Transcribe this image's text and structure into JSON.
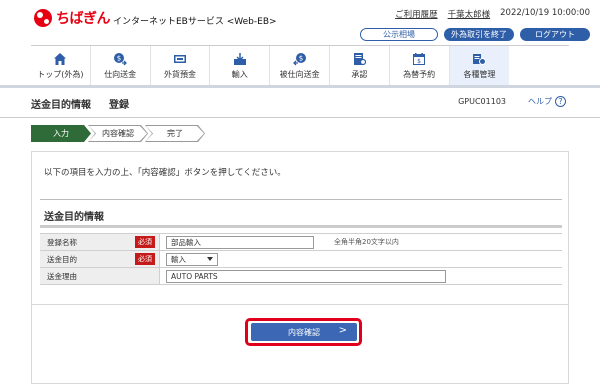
{
  "brand": {
    "bank_name": "ちばぎん",
    "service_name": "インターネットEBサービス <Web-EB>",
    "accent_color": "#e60012",
    "primary_color": "#2f5ea8"
  },
  "header": {
    "usage_history": "ご利用履歴",
    "user_name": "千葉太郎様",
    "datetime": "2022/10/19 10:00:00",
    "fx_rates_button": "公示相場",
    "end_fx_button": "外為取引を終了",
    "logout_button": "ログアウト"
  },
  "nav": [
    {
      "label": "トップ(外為)",
      "icon": "home-icon"
    },
    {
      "label": "仕向送金",
      "icon": "outward-remittance-icon"
    },
    {
      "label": "外貨預金",
      "icon": "foreign-deposit-icon"
    },
    {
      "label": "輸入",
      "icon": "import-icon"
    },
    {
      "label": "被仕向送金",
      "icon": "inward-remittance-icon"
    },
    {
      "label": "承認",
      "icon": "approval-icon"
    },
    {
      "label": "為替予約",
      "icon": "fx-booking-icon"
    },
    {
      "label": "各種管理",
      "icon": "management-icon",
      "active": true
    }
  ],
  "page": {
    "title": "送金目的情報",
    "subtitle": "登録",
    "page_id": "GPUC01103",
    "help": "ヘルプ",
    "help_symbol": "?"
  },
  "steps": [
    "入力",
    "内容確認",
    "完了"
  ],
  "instruction": "以下の項目を入力の上、「内容確認」ボタンを押してください。",
  "section_title": "送金目的情報",
  "form": {
    "required_badge": "必須",
    "name_label": "登録名称",
    "name_value": "部品輸入",
    "name_hint": "全角半角20文字以内",
    "purpose_label": "送金目的",
    "purpose_value": "輸入",
    "reason_label": "送金理由",
    "reason_value": "AUTO PARTS"
  },
  "submit_button": "内容確認",
  "submit_chevron": ">"
}
